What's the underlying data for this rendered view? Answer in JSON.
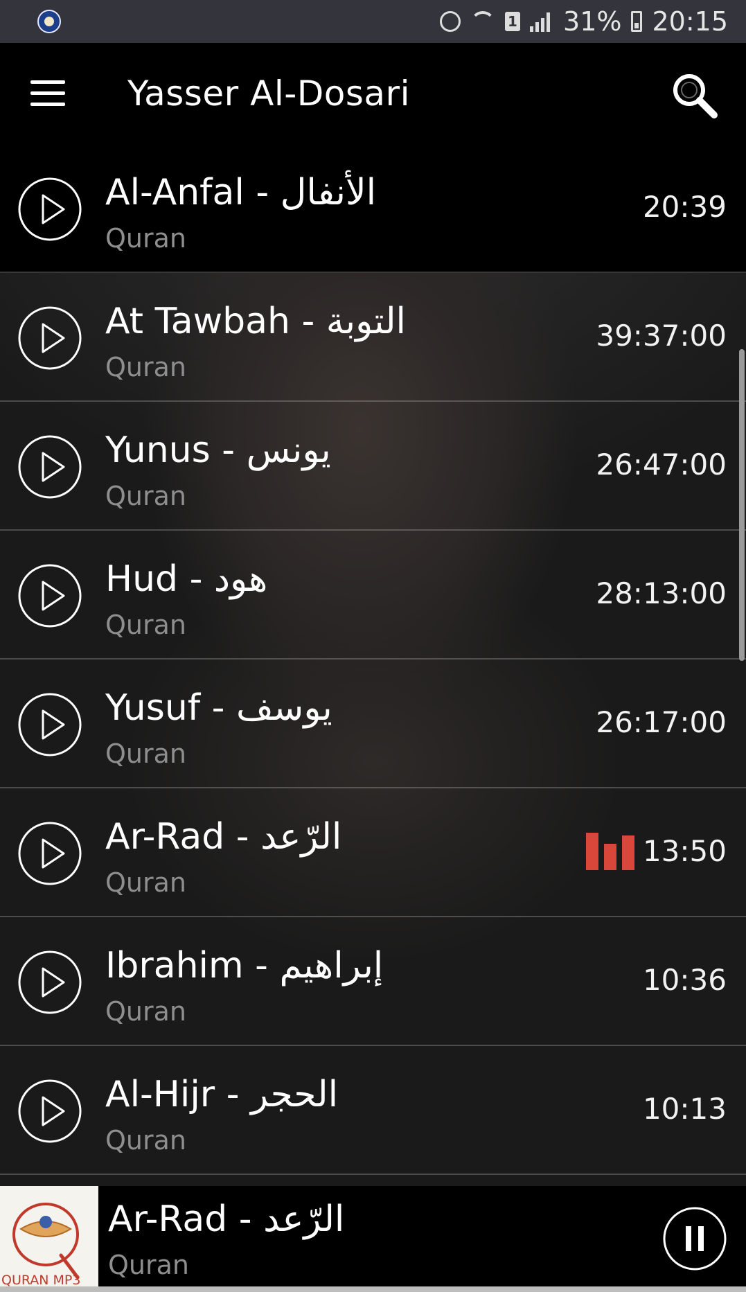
{
  "status_bar": {
    "battery": "31%",
    "time": "20:15",
    "sim_slot": "1",
    "icons": [
      "app-icon",
      "alarm-icon",
      "wifi-icon",
      "sim-icon",
      "signal-icon",
      "battery-icon"
    ]
  },
  "app_bar": {
    "title": "Yasser Al-Dosari",
    "menu_icon": "hamburger-menu-icon",
    "search_icon": "search-icon"
  },
  "tracks": [
    {
      "title": "Al-Anfal - الأنفال",
      "subtitle": "Quran",
      "duration": "20:39",
      "playing": false
    },
    {
      "title": "At Tawbah - التوبة",
      "subtitle": "Quran",
      "duration": "39:37:00",
      "playing": false
    },
    {
      "title": "Yunus - يونس",
      "subtitle": "Quran",
      "duration": "26:47:00",
      "playing": false
    },
    {
      "title": "Hud - هود",
      "subtitle": "Quran",
      "duration": "28:13:00",
      "playing": false
    },
    {
      "title": "Yusuf - يوسف",
      "subtitle": "Quran",
      "duration": "26:17:00",
      "playing": false
    },
    {
      "title": "Ar-Rad - الرّعد",
      "subtitle": "Quran",
      "duration": "13:50",
      "playing": true
    },
    {
      "title": "Ibrahim - إبراهيم",
      "subtitle": "Quran",
      "duration": "10:36",
      "playing": false
    },
    {
      "title": "Al-Hijr - الحجر",
      "subtitle": "Quran",
      "duration": "10:13",
      "playing": false
    }
  ],
  "player": {
    "title": "Ar-Rad - الرّعد",
    "subtitle": "Quran",
    "art_label": "QURAN MP3",
    "control_icon": "pause-icon"
  },
  "colors": {
    "app_bar": "#000000",
    "status_bar": "#34343c",
    "equalizer": "#d9473b",
    "subtitle": "#8e8e8e"
  }
}
